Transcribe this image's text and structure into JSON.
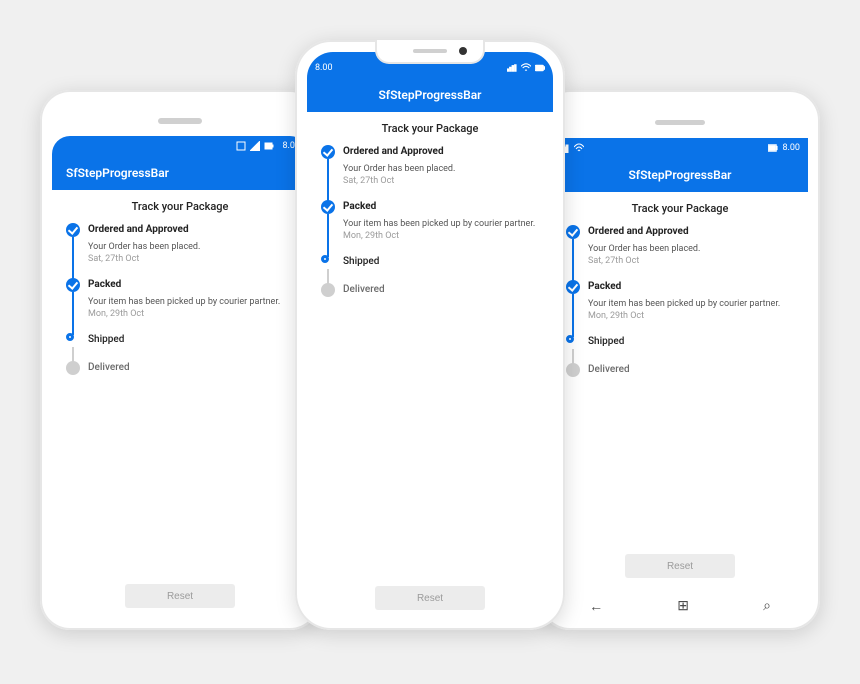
{
  "app": {
    "title": "SfStepProgressBar"
  },
  "statusbar": {
    "time": "8.00"
  },
  "page": {
    "title": "Track your Package"
  },
  "steps": [
    {
      "state": "done",
      "title": "Ordered and Approved",
      "desc": "Your Order has been placed.",
      "date": "Sat, 27th Oct"
    },
    {
      "state": "done",
      "title": "Packed",
      "desc": "Your item has been picked up by courier partner.",
      "date": "Mon, 29th Oct"
    },
    {
      "state": "active",
      "title": "Shipped",
      "desc": "",
      "date": ""
    },
    {
      "state": "pending",
      "title": "Delivered",
      "desc": "",
      "date": ""
    }
  ],
  "buttons": {
    "reset": "Reset"
  },
  "win_hw": {
    "back": "←",
    "home": "⊞",
    "search": "⌕"
  }
}
